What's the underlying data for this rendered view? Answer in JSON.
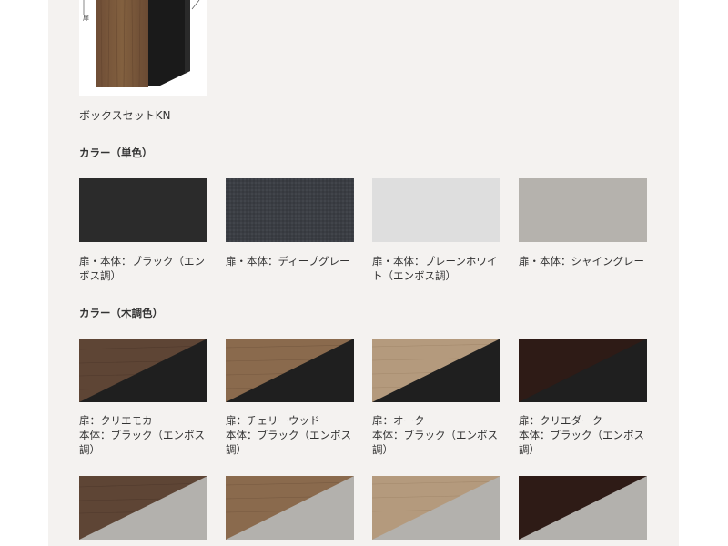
{
  "product": {
    "name": "ボックスセットKN",
    "diagram_label": "扉"
  },
  "solid_section": {
    "heading": "カラー（単色）",
    "items": [
      {
        "caption": "扉・本体：ブラック（エンボス調）",
        "color": "#2b2b2b"
      },
      {
        "caption": "扉・本体：ディープグレー",
        "color": "#3b3e44"
      },
      {
        "caption": "扉・本体：プレーンホワイト（エンボス調）",
        "color": "#dedede"
      },
      {
        "caption": "扉・本体：シャイングレー",
        "color": "#b5b2ad"
      }
    ]
  },
  "wood_section": {
    "heading": "カラー（木調色）",
    "items": [
      {
        "door": "扉：クリエモカ",
        "body": "本体：ブラック（エンボス調）",
        "wood_color": "#5e4535",
        "body_color": "#1f1f1f"
      },
      {
        "door": "扉：チェリーウッド",
        "body": "本体：ブラック（エンボス調）",
        "wood_color": "#8a6a4d",
        "body_color": "#1f1f1f"
      },
      {
        "door": "扉：オーク",
        "body": "本体：ブラック（エンボス調）",
        "wood_color": "#b49a7d",
        "body_color": "#1f1f1f"
      },
      {
        "door": "扉：クリエダーク",
        "body": "本体：ブラック（エンボス調）",
        "wood_color": "#2e1b16",
        "body_color": "#1f1f1f"
      }
    ],
    "row2": [
      {
        "wood_color": "#5e4535",
        "body_color": "#b3b1ad"
      },
      {
        "wood_color": "#8a6a4d",
        "body_color": "#b3b1ad"
      },
      {
        "wood_color": "#b49a7d",
        "body_color": "#b3b1ad"
      },
      {
        "wood_color": "#2e1b16",
        "body_color": "#b3b1ad"
      }
    ]
  }
}
